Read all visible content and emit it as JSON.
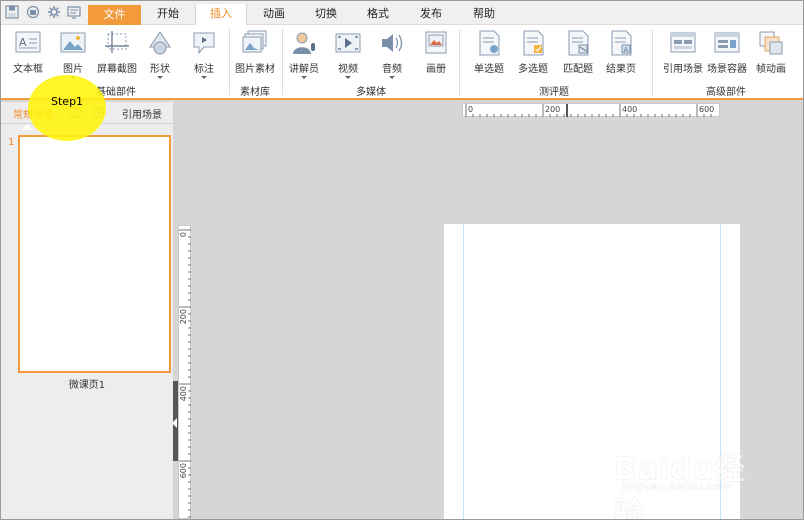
{
  "colors": {
    "accent": "#f39a3d",
    "accent_text": "#f08a24",
    "highlight": "#fff40a",
    "guide": "#c8e4f4"
  },
  "quick_access": [
    {
      "name": "save-icon"
    },
    {
      "name": "publish-icon"
    },
    {
      "name": "settings-icon"
    },
    {
      "name": "preview-icon"
    }
  ],
  "menu": {
    "tabs": [
      {
        "label": "文件",
        "name": "tab-file"
      },
      {
        "label": "开始",
        "name": "tab-home"
      },
      {
        "label": "插入",
        "name": "tab-insert"
      },
      {
        "label": "动画",
        "name": "tab-animation"
      },
      {
        "label": "切换",
        "name": "tab-transition"
      },
      {
        "label": "格式",
        "name": "tab-format"
      },
      {
        "label": "发布",
        "name": "tab-publish"
      },
      {
        "label": "帮助",
        "name": "tab-help"
      }
    ],
    "active": "插入"
  },
  "ribbon": {
    "basic": {
      "label": "基础部件",
      "items": [
        {
          "label": "文本框",
          "icon": "textbox-icon"
        },
        {
          "label": "图片",
          "icon": "image-icon"
        },
        {
          "label": "屏幕截图",
          "icon": "screenshot-icon"
        },
        {
          "label": "形状",
          "icon": "shape-icon"
        },
        {
          "label": "标注",
          "icon": "callout-icon"
        }
      ]
    },
    "library": {
      "label": "素材库",
      "items": [
        {
          "label": "图片素材",
          "icon": "image-library-icon"
        }
      ]
    },
    "media": {
      "label": "多媒体",
      "items": [
        {
          "label": "讲解员",
          "icon": "narrator-icon"
        },
        {
          "label": "视频",
          "icon": "video-icon"
        },
        {
          "label": "音频",
          "icon": "audio-icon"
        },
        {
          "label": "画册",
          "icon": "album-icon"
        }
      ]
    },
    "quiz": {
      "label": "测评题",
      "items": [
        {
          "label": "单选题",
          "icon": "single-choice-icon"
        },
        {
          "label": "多选题",
          "icon": "multi-choice-icon"
        },
        {
          "label": "匹配题",
          "icon": "matching-icon"
        },
        {
          "label": "结果页",
          "icon": "result-page-icon"
        }
      ]
    },
    "advanced": {
      "label": "高级部件",
      "items": [
        {
          "label": "引用场景",
          "icon": "reference-scene-icon"
        },
        {
          "label": "场景容器",
          "icon": "scene-container-icon"
        },
        {
          "label": "帧动画",
          "icon": "frame-animation-icon"
        }
      ]
    }
  },
  "left_panel": {
    "tabs": [
      "常规场景",
      "引用场景"
    ],
    "active_tab": "常规场景",
    "slides": [
      {
        "number": "1",
        "title": "微课页1"
      }
    ]
  },
  "annotation": {
    "label": "Step1"
  },
  "rulers": {
    "top_labels": [
      "0",
      "200",
      "400",
      "600"
    ],
    "left_labels": [
      "0",
      "200",
      "400",
      "600"
    ]
  },
  "watermark": {
    "logo": "Baidu经验",
    "url": "jingyan.baidu.com"
  }
}
